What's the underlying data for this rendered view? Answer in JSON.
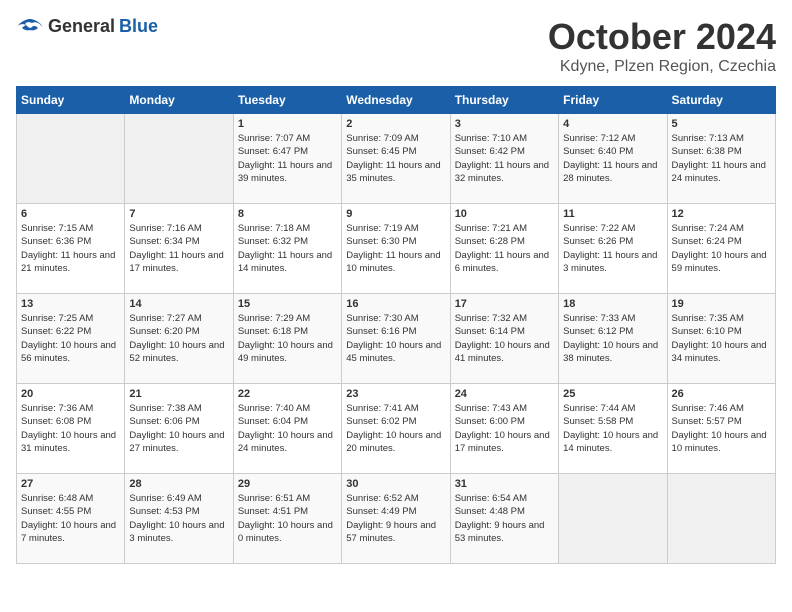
{
  "header": {
    "logo_general": "General",
    "logo_blue": "Blue",
    "month": "October 2024",
    "location": "Kdyne, Plzen Region, Czechia"
  },
  "days_of_week": [
    "Sunday",
    "Monday",
    "Tuesday",
    "Wednesday",
    "Thursday",
    "Friday",
    "Saturday"
  ],
  "weeks": [
    [
      {
        "day": "",
        "info": ""
      },
      {
        "day": "",
        "info": ""
      },
      {
        "day": "1",
        "info": "Sunrise: 7:07 AM\nSunset: 6:47 PM\nDaylight: 11 hours and 39 minutes."
      },
      {
        "day": "2",
        "info": "Sunrise: 7:09 AM\nSunset: 6:45 PM\nDaylight: 11 hours and 35 minutes."
      },
      {
        "day": "3",
        "info": "Sunrise: 7:10 AM\nSunset: 6:42 PM\nDaylight: 11 hours and 32 minutes."
      },
      {
        "day": "4",
        "info": "Sunrise: 7:12 AM\nSunset: 6:40 PM\nDaylight: 11 hours and 28 minutes."
      },
      {
        "day": "5",
        "info": "Sunrise: 7:13 AM\nSunset: 6:38 PM\nDaylight: 11 hours and 24 minutes."
      }
    ],
    [
      {
        "day": "6",
        "info": "Sunrise: 7:15 AM\nSunset: 6:36 PM\nDaylight: 11 hours and 21 minutes."
      },
      {
        "day": "7",
        "info": "Sunrise: 7:16 AM\nSunset: 6:34 PM\nDaylight: 11 hours and 17 minutes."
      },
      {
        "day": "8",
        "info": "Sunrise: 7:18 AM\nSunset: 6:32 PM\nDaylight: 11 hours and 14 minutes."
      },
      {
        "day": "9",
        "info": "Sunrise: 7:19 AM\nSunset: 6:30 PM\nDaylight: 11 hours and 10 minutes."
      },
      {
        "day": "10",
        "info": "Sunrise: 7:21 AM\nSunset: 6:28 PM\nDaylight: 11 hours and 6 minutes."
      },
      {
        "day": "11",
        "info": "Sunrise: 7:22 AM\nSunset: 6:26 PM\nDaylight: 11 hours and 3 minutes."
      },
      {
        "day": "12",
        "info": "Sunrise: 7:24 AM\nSunset: 6:24 PM\nDaylight: 10 hours and 59 minutes."
      }
    ],
    [
      {
        "day": "13",
        "info": "Sunrise: 7:25 AM\nSunset: 6:22 PM\nDaylight: 10 hours and 56 minutes."
      },
      {
        "day": "14",
        "info": "Sunrise: 7:27 AM\nSunset: 6:20 PM\nDaylight: 10 hours and 52 minutes."
      },
      {
        "day": "15",
        "info": "Sunrise: 7:29 AM\nSunset: 6:18 PM\nDaylight: 10 hours and 49 minutes."
      },
      {
        "day": "16",
        "info": "Sunrise: 7:30 AM\nSunset: 6:16 PM\nDaylight: 10 hours and 45 minutes."
      },
      {
        "day": "17",
        "info": "Sunrise: 7:32 AM\nSunset: 6:14 PM\nDaylight: 10 hours and 41 minutes."
      },
      {
        "day": "18",
        "info": "Sunrise: 7:33 AM\nSunset: 6:12 PM\nDaylight: 10 hours and 38 minutes."
      },
      {
        "day": "19",
        "info": "Sunrise: 7:35 AM\nSunset: 6:10 PM\nDaylight: 10 hours and 34 minutes."
      }
    ],
    [
      {
        "day": "20",
        "info": "Sunrise: 7:36 AM\nSunset: 6:08 PM\nDaylight: 10 hours and 31 minutes."
      },
      {
        "day": "21",
        "info": "Sunrise: 7:38 AM\nSunset: 6:06 PM\nDaylight: 10 hours and 27 minutes."
      },
      {
        "day": "22",
        "info": "Sunrise: 7:40 AM\nSunset: 6:04 PM\nDaylight: 10 hours and 24 minutes."
      },
      {
        "day": "23",
        "info": "Sunrise: 7:41 AM\nSunset: 6:02 PM\nDaylight: 10 hours and 20 minutes."
      },
      {
        "day": "24",
        "info": "Sunrise: 7:43 AM\nSunset: 6:00 PM\nDaylight: 10 hours and 17 minutes."
      },
      {
        "day": "25",
        "info": "Sunrise: 7:44 AM\nSunset: 5:58 PM\nDaylight: 10 hours and 14 minutes."
      },
      {
        "day": "26",
        "info": "Sunrise: 7:46 AM\nSunset: 5:57 PM\nDaylight: 10 hours and 10 minutes."
      }
    ],
    [
      {
        "day": "27",
        "info": "Sunrise: 6:48 AM\nSunset: 4:55 PM\nDaylight: 10 hours and 7 minutes."
      },
      {
        "day": "28",
        "info": "Sunrise: 6:49 AM\nSunset: 4:53 PM\nDaylight: 10 hours and 3 minutes."
      },
      {
        "day": "29",
        "info": "Sunrise: 6:51 AM\nSunset: 4:51 PM\nDaylight: 10 hours and 0 minutes."
      },
      {
        "day": "30",
        "info": "Sunrise: 6:52 AM\nSunset: 4:49 PM\nDaylight: 9 hours and 57 minutes."
      },
      {
        "day": "31",
        "info": "Sunrise: 6:54 AM\nSunset: 4:48 PM\nDaylight: 9 hours and 53 minutes."
      },
      {
        "day": "",
        "info": ""
      },
      {
        "day": "",
        "info": ""
      }
    ]
  ]
}
